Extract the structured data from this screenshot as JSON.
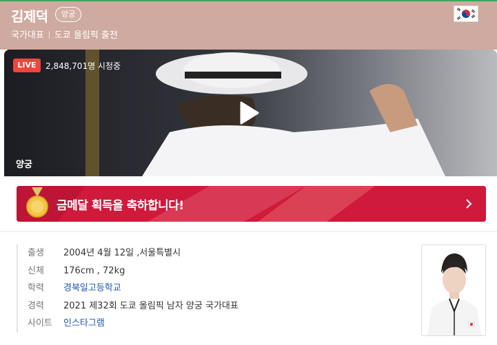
{
  "header": {
    "name": "김제덕",
    "sport_tag": "양궁",
    "subtitle_left": "국가대표",
    "subtitle_right": "도쿄 올림픽 출전",
    "flag_icon": "south-korea-flag-icon"
  },
  "video": {
    "live_label": "LIVE",
    "viewer_count": "2,848,701명 시청중",
    "sport_label": "양궁",
    "play_icon": "play-icon"
  },
  "banner": {
    "text": "금메달 획득을 축하합니다!",
    "medal_icon": "gold-medal-icon",
    "arrow_icon": "chevron-right-icon"
  },
  "profile": {
    "rows": [
      {
        "label": "출생",
        "value": "2004년 4월 12일 ,서울특별시"
      },
      {
        "label": "신체",
        "value": "176cm , 72kg"
      },
      {
        "label": "학력",
        "value": "경북일고등학교"
      },
      {
        "label": "경력",
        "value": "2021 제32회 도쿄 올림픽 남자 양궁 국가대표"
      },
      {
        "label": "사이트",
        "value": "인스타그램"
      }
    ]
  },
  "colors": {
    "header_bg": "#cfaaa0",
    "live_red": "#f1453d",
    "banner_red": "#cf1a3c",
    "link_blue": "#2357b5"
  }
}
